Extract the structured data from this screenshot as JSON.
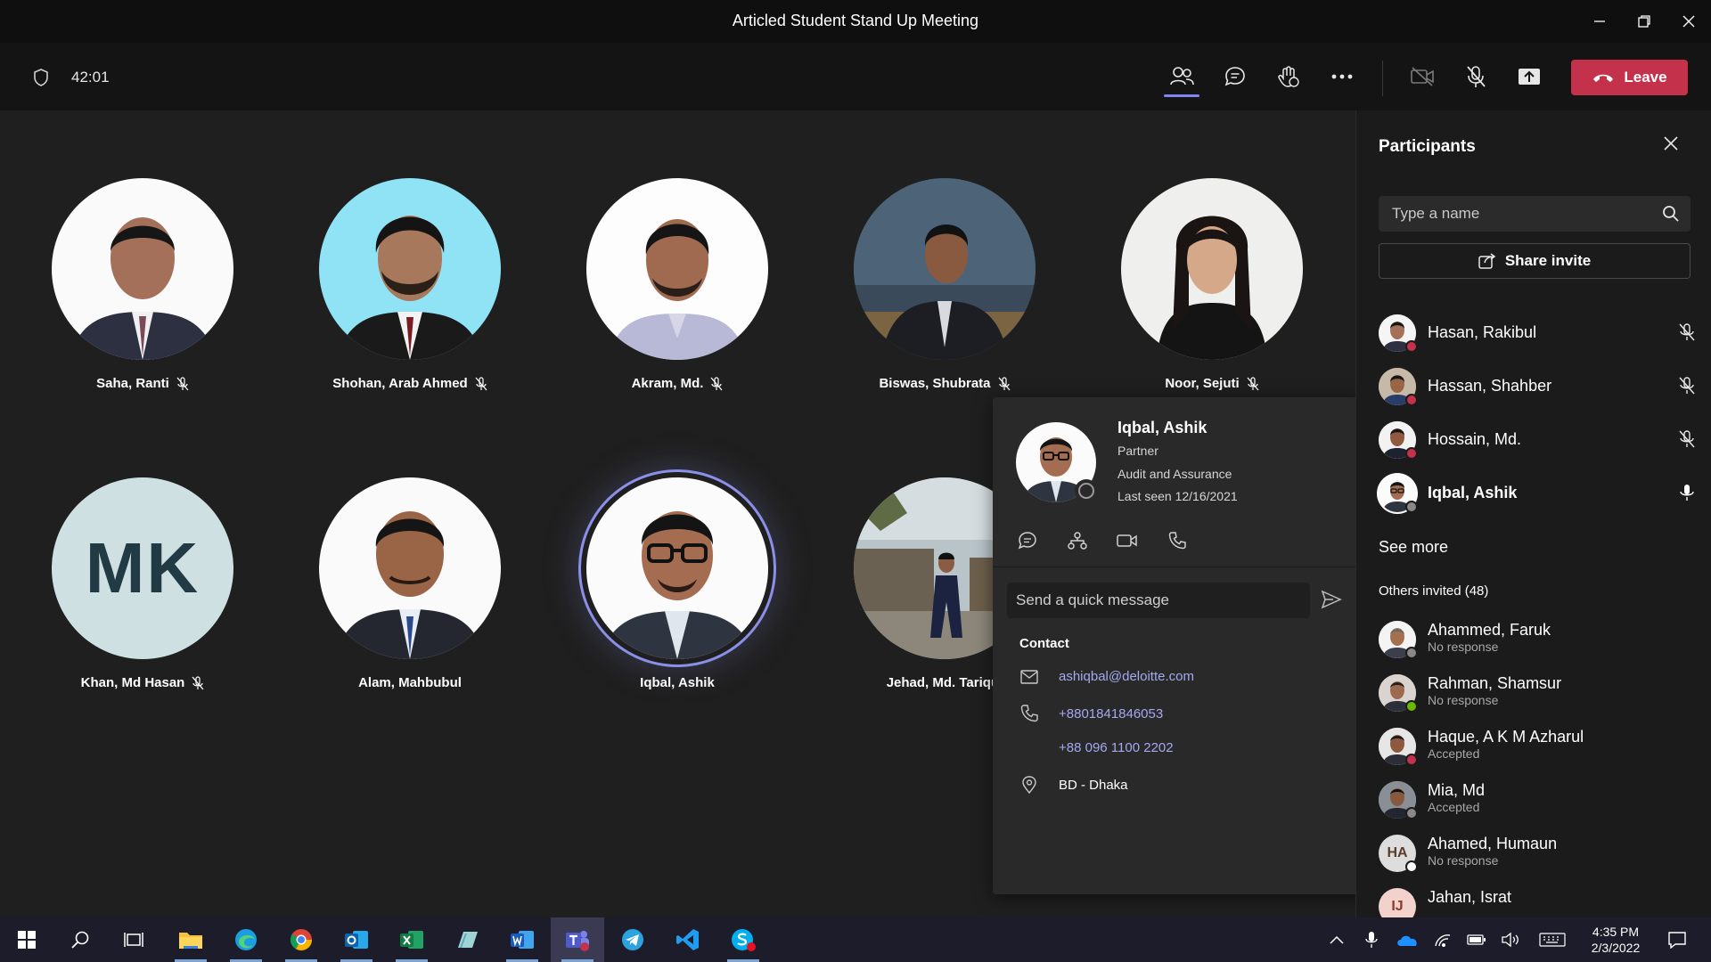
{
  "window": {
    "title": "Articled Student Stand Up Meeting"
  },
  "meeting": {
    "timer": "42:01",
    "leave_label": "Leave"
  },
  "tiles": [
    {
      "name": "Saha, Ranti",
      "muted": true
    },
    {
      "name": "Shohan, Arab Ahmed",
      "muted": true
    },
    {
      "name": "Akram, Md.",
      "muted": true
    },
    {
      "name": "Biswas, Shubrata",
      "muted": true
    },
    {
      "name": "Noor, Sejuti",
      "muted": true
    },
    {
      "name": "Khan, Md Hasan",
      "muted": true,
      "initials": "MK"
    },
    {
      "name": "Alam, Mahbubul",
      "muted": false
    },
    {
      "name": "Iqbal, Ashik",
      "muted": false,
      "speaking": true
    },
    {
      "name": "Jehad, Md. Tariqul",
      "muted": false
    }
  ],
  "profile_card": {
    "name": "Iqbal, Ashik",
    "title": "Partner",
    "department": "Audit and Assurance",
    "last_seen": "Last seen 12/16/2021",
    "quick_message_placeholder": "Send a quick message",
    "contact_heading": "Contact",
    "email": "ashiqbal@deloitte.com",
    "phone1": "+8801841846053",
    "phone2": "+88 096 1100 2202",
    "location": "BD - Dhaka"
  },
  "participants_panel": {
    "title": "Participants",
    "search_placeholder": "Type a name",
    "share_invite_label": "Share invite",
    "in_meeting": [
      {
        "name": "Hasan, Rakibul",
        "muted": true,
        "status_color": "#c4314b"
      },
      {
        "name": "Hassan, Shahber",
        "muted": true,
        "status_color": "#c4314b"
      },
      {
        "name": "Hossain, Md.",
        "muted": true,
        "status_color": "#c4314b"
      },
      {
        "name": "Iqbal, Ashik",
        "muted": false,
        "status_color": "#8a8886"
      }
    ],
    "see_more_label": "See more",
    "others_invited_label": "Others invited (48)",
    "invited": [
      {
        "name": "Ahammed, Faruk",
        "status": "No response",
        "status_color": "#8a8886"
      },
      {
        "name": "Rahman, Shamsur",
        "status": "No response",
        "status_color": "#6bb700"
      },
      {
        "name": "Haque, A K M Azharul",
        "status": "Accepted",
        "status_color": "#c4314b"
      },
      {
        "name": "Mia, Md",
        "status": "Accepted",
        "status_color": "#8a8886"
      },
      {
        "name": "Ahamed, Humaun",
        "status": "No response",
        "status_color": "#ffffff",
        "initials": "HA"
      },
      {
        "name": "Jahan, Israt",
        "status": "",
        "status_color": "#8a8886",
        "initials": "IJ"
      }
    ]
  },
  "taskbar": {
    "time": "4:35 PM",
    "date": "2/3/2022"
  },
  "colors": {
    "accent": "#7f85f5",
    "leave": "#c4314b",
    "link": "#a6a8f0"
  }
}
